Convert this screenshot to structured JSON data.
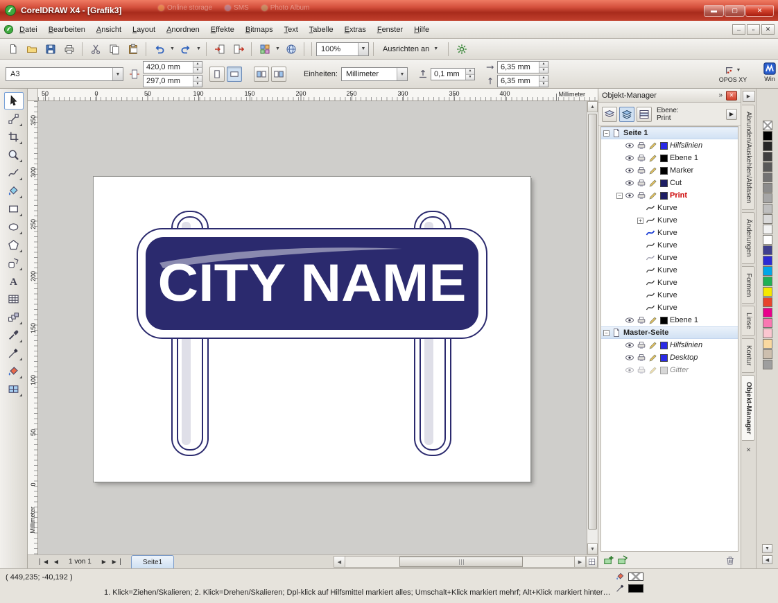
{
  "window": {
    "title": "CorelDRAW X4 - [Grafik3]",
    "ghost_toolbar_items": [
      "Online storage",
      "SMS",
      "Photo Album"
    ]
  },
  "menu": {
    "items": [
      "Datei",
      "Bearbeiten",
      "Ansicht",
      "Layout",
      "Anordnen",
      "Effekte",
      "Bitmaps",
      "Text",
      "Tabelle",
      "Extras",
      "Fenster",
      "Hilfe"
    ]
  },
  "toolbar": {
    "buttons": [
      {
        "name": "new-document",
        "icon": "newdoc"
      },
      {
        "name": "open",
        "icon": "folder"
      },
      {
        "name": "save",
        "icon": "save"
      },
      {
        "name": "print",
        "icon": "print"
      },
      {
        "name": "cut",
        "icon": "cut"
      },
      {
        "name": "copy",
        "icon": "copy"
      },
      {
        "name": "paste",
        "icon": "paste"
      },
      {
        "name": "undo",
        "icon": "undo",
        "dropdown": true
      },
      {
        "name": "redo",
        "icon": "redo",
        "dropdown": true
      },
      {
        "name": "import",
        "icon": "import"
      },
      {
        "name": "export",
        "icon": "export"
      },
      {
        "name": "application-launcher",
        "icon": "launcher",
        "dropdown": true
      },
      {
        "name": "corel-online",
        "icon": "globe"
      }
    ],
    "zoom_value": "100%",
    "snap_label": "Ausrichten an",
    "options_icon": "gear"
  },
  "property_bar": {
    "paper_size": "A3",
    "paper_width": "420,0 mm",
    "paper_height": "297,0 mm",
    "units_label": "Einheiten:",
    "units_value": "Millimeter",
    "nudge_value": "0,1 mm",
    "duplicate_x": "6,35 mm",
    "duplicate_y": "6,35 mm",
    "opos_label": "OPOS XY",
    "plugin_label": "Win"
  },
  "toolbox": {
    "tools": [
      {
        "name": "pick-tool",
        "icon": "pick",
        "selected": true
      },
      {
        "name": "shape-tool",
        "icon": "shape",
        "flyout": true
      },
      {
        "name": "crop-tool",
        "icon": "crop",
        "flyout": true
      },
      {
        "name": "zoom-tool",
        "icon": "zoomt",
        "flyout": true
      },
      {
        "name": "freehand-tool",
        "icon": "freehand",
        "flyout": true
      },
      {
        "name": "smart-fill-tool",
        "icon": "smartfill",
        "flyout": true
      },
      {
        "name": "rectangle-tool",
        "icon": "recttool",
        "flyout": true
      },
      {
        "name": "ellipse-tool",
        "icon": "ellipsetool",
        "flyout": true
      },
      {
        "name": "polygon-tool",
        "icon": "polygontool",
        "flyout": true
      },
      {
        "name": "basic-shapes-tool",
        "icon": "shapestool",
        "flyout": true
      },
      {
        "name": "text-tool",
        "icon": "texttool"
      },
      {
        "name": "table-tool",
        "icon": "tabletool"
      },
      {
        "name": "interactive-blend-tool",
        "icon": "blendtool",
        "flyout": true
      },
      {
        "name": "eyedropper-tool",
        "icon": "eyedropper",
        "flyout": true
      },
      {
        "name": "outline-tool",
        "icon": "outlinepen",
        "flyout": true
      },
      {
        "name": "fill-tool",
        "icon": "fillbucket",
        "flyout": true
      },
      {
        "name": "interactive-fill-tool",
        "icon": "meshfill",
        "flyout": true
      }
    ]
  },
  "rulers": {
    "horizontal_numbers": [
      "50",
      "0",
      "50",
      "100",
      "150",
      "200",
      "250",
      "300",
      "350",
      "400"
    ],
    "horizontal_unit": "Millimeter",
    "vertical_numbers": [
      "350",
      "300",
      "250",
      "200",
      "150",
      "100",
      "50",
      "0"
    ],
    "vertical_unit": "Millimeter"
  },
  "canvas": {
    "sign_text": "CITY NAME",
    "sign_color": "#2b2a6e"
  },
  "object_manager": {
    "title": "Objekt-Manager",
    "layer_label": "Ebene:",
    "layer_value": "Print",
    "tree": [
      {
        "level": 0,
        "expander": "minus",
        "icon": "pagei",
        "label": "Seite 1",
        "bold": true,
        "band": true
      },
      {
        "level": 1,
        "controls": true,
        "chip": "#2a2ae6",
        "label": "Hilfslinien",
        "italic": true
      },
      {
        "level": 1,
        "controls": true,
        "chip": "#000000",
        "label": "Ebene 1"
      },
      {
        "level": 1,
        "controls": true,
        "chip": "#000000",
        "label": "Marker"
      },
      {
        "level": 1,
        "controls": true,
        "chip": "#1e1e64",
        "label": "Cut"
      },
      {
        "level": 1,
        "controls": true,
        "chip": "#1e1e64",
        "label": "Print",
        "color": "#cc0000",
        "bold": true,
        "expander": "minus"
      },
      {
        "level": 2,
        "icon": "curve",
        "label": "Kurve"
      },
      {
        "level": 2,
        "icon": "curve",
        "label": "Kurve",
        "expander": "plus"
      },
      {
        "level": 2,
        "icon": "curveblue",
        "label": "Kurve"
      },
      {
        "level": 2,
        "icon": "curve",
        "label": "Kurve"
      },
      {
        "level": 2,
        "icon": "curvelight",
        "label": "Kurve"
      },
      {
        "level": 2,
        "icon": "curve",
        "label": "Kurve"
      },
      {
        "level": 2,
        "icon": "curve",
        "label": "Kurve"
      },
      {
        "level": 2,
        "icon": "curve",
        "label": "Kurve"
      },
      {
        "level": 2,
        "icon": "curve",
        "label": "Kurve"
      },
      {
        "level": 1,
        "controls": true,
        "chip": "#000000",
        "label": "Ebene 1"
      },
      {
        "level": 0,
        "expander": "minus",
        "icon": "pagei",
        "label": "Master-Seite",
        "bold": true,
        "band": true
      },
      {
        "level": 1,
        "controls": true,
        "chip": "#2a2ae6",
        "label": "Hilfslinien",
        "italic": true
      },
      {
        "level": 1,
        "controls": true,
        "chip": "#2a2ae6",
        "label": "Desktop",
        "italic": true
      },
      {
        "level": 1,
        "controls": true,
        "chip": "#b0b0b0",
        "label": "Gitter",
        "italic": true,
        "dim": true
      }
    ]
  },
  "docker_tabs": {
    "tabs": [
      "Abrunden/Auskehlen/Abfasen",
      "Änderungen",
      "Formen",
      "Linse",
      "Kontur",
      "Objekt-Manager"
    ],
    "active_index": 5
  },
  "palette": {
    "colors": [
      "none",
      "#000000",
      "#262626",
      "#404040",
      "#595959",
      "#737373",
      "#8c8c8c",
      "#a6a6a6",
      "#bfbfbf",
      "#d9d9d9",
      "#f2f2f2",
      "#ffffff",
      "#3f3f8f",
      "#2b2bd4",
      "#00a6e8",
      "#1fb055",
      "#f5e800",
      "#e8442c",
      "#e8008c",
      "#f977b2",
      "#fbc6d0",
      "#f9d9a0",
      "#cdbfae",
      "#9e9e9e"
    ]
  },
  "navigator": {
    "page_info": "1 von 1",
    "page_tab": "Seite1"
  },
  "status_bar": {
    "coordinates": "( 449,235; -40,192 )",
    "hint": "1. Klick=Ziehen/Skalieren; 2. Klick=Drehen/Skalieren; Dpl-klick auf Hilfsmittel markiert alles; Umschalt+Klick markiert mehrf; Alt+Klick markiert hinter…"
  }
}
